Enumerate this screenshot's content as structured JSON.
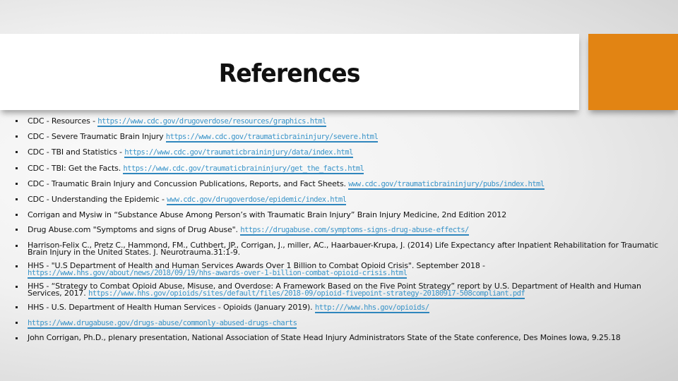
{
  "slide": {
    "title": "References",
    "accent_color": "#e28413",
    "link_color": "#3a94c9"
  },
  "references": [
    {
      "text": "CDC - Resources - ",
      "link": "https://www.cdc.gov/drugoverdose/resources/graphics.html",
      "after": ""
    },
    {
      "text": "CDC - Severe Traumatic Brain Injury ",
      "link": "https://www.cdc.gov/traumaticbraininjury/severe.html",
      "after": ""
    },
    {
      "text": "CDC - TBI and Statistics -  ",
      "link": "https://www.cdc.gov/traumaticbraininjury/data/index.html",
      "after": ""
    },
    {
      "text": "CDC - TBI: Get the Facts. ",
      "link": "https://www.cdc.gov/traumaticbraininjury/get_the_facts.html",
      "after": ""
    },
    {
      "text": "CDC - Traumatic Brain Injury and Concussion Publications, Reports, and Fact Sheets. ",
      "link": "www.cdc.gov/traumaticbraininjury/pubs/index.html",
      "after": ""
    },
    {
      "text": "CDC - Understanding the Epidemic - ",
      "link": "www.cdc.gov/drugoverdose/epidemic/index.html",
      "after": ""
    },
    {
      "text": "Corrigan and Mysiw in “Substance Abuse Among Person’s with Traumatic Brain Injury” Brain Injury Medicine, 2nd Edition 2012",
      "link": "",
      "after": ""
    },
    {
      "text": "Drug Abuse.com \"Symptoms and signs of Drug Abuse\". ",
      "link": "https://drugabuse.com/symptoms-signs-drug-abuse-effects/",
      "after": ""
    },
    {
      "text": "Harrison-Felix C., Pretz C., Hammond, FM., Cuthbert, JP., Corrigan, J., miller, AC., Haarbauer-Krupa, J. (2014) Life Expectancy after Inpatient Rehabilitation for Traumatic Brain Injury in the United States. J. Neurotrauma.31:1-9.",
      "link": "",
      "after": ""
    },
    {
      "text": "HHS - \"U.S Department of Health and Human Services Awards Over 1 Billion to Combat Opioid Crisis\". September 2018 - ",
      "link": "https://www.hhs.gov/about/news/2018/09/19/hhs-awards-over-1-billion-combat-opioid-crisis.html",
      "after": ""
    },
    {
      "text": "HHS - “Strategy to Combat Opioid Abuse, Misuse, and Overdose: A Framework Based on the Five Point Strategy” report by U.S. Department of Health and Human Services, 2017. ",
      "link": "https://www.hhs.gov/opioids/sites/default/files/2018-09/opioid-fivepoint-strategy-20180917-508compliant.pdf",
      "after": ""
    },
    {
      "text": "HHS - U.S. Department of Health Human Services - Opioids (January 2019). ",
      "link": "http:///www.hhs.gov/opioids/",
      "after": ""
    },
    {
      "text": "",
      "link": "https://www.drugabuse.gov/drugs-abuse/commonly-abused-drugs-charts",
      "after": ""
    },
    {
      "text": "John Corrigan, Ph.D., plenary presentation, National Association of State Head Injury Administrators State of the State conference, Des Moines Iowa, 9.25.18",
      "link": "",
      "after": ""
    }
  ]
}
